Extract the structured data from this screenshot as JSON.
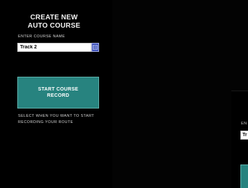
{
  "panel": {
    "title_line1": "CREATE NEW",
    "title_line2": "AUTO COURSE",
    "name_label": "ENTER COURSE NAME",
    "name_value": "Track 2",
    "start_button_label": "START COURSE RECORD",
    "hint": "SELECT WHEN YOU WANT TO START RECORDING YOUR ROUTE"
  },
  "next_panel": {
    "label_fragment": "EN",
    "field_fragment": "Tr"
  },
  "colors": {
    "background": "#000000",
    "button_teal": "#27837f",
    "keyboard_blue": "#3b4fb8",
    "text": "#f2f2f2"
  },
  "icons": {
    "keyboard": "keyboard-icon"
  }
}
